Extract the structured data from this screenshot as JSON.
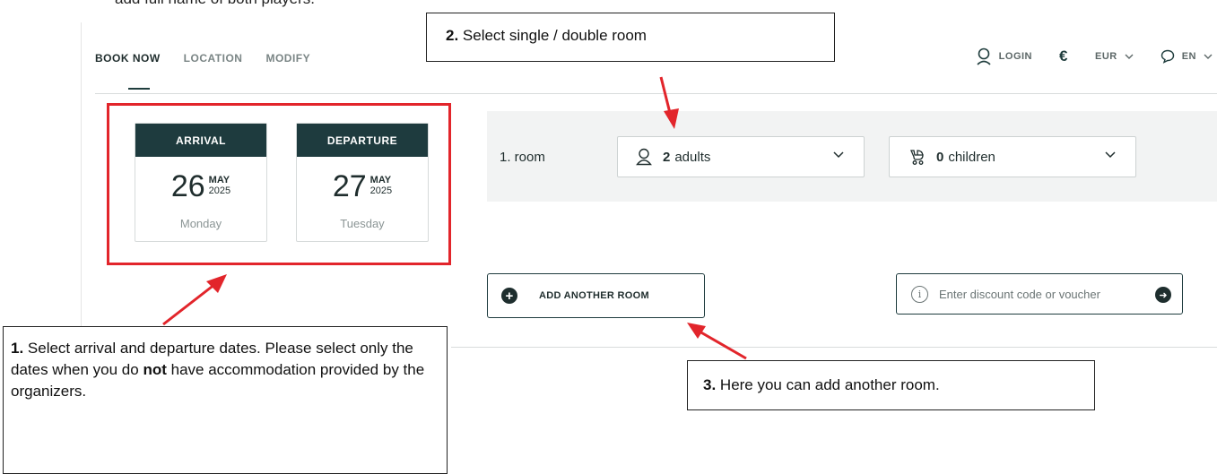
{
  "header_text": "add full name of both players.",
  "nav": {
    "tabs": [
      {
        "label": "BOOK NOW",
        "active": true
      },
      {
        "label": "LOCATION",
        "active": false
      },
      {
        "label": "MODIFY",
        "active": false
      }
    ],
    "login_label": "LOGIN",
    "currency_symbol": "€",
    "currency_label": "EUR",
    "language_label": "EN"
  },
  "arrival": {
    "label": "ARRIVAL",
    "day": "26",
    "month": "MAY",
    "year": "2025",
    "weekday": "Monday"
  },
  "departure": {
    "label": "DEPARTURE",
    "day": "27",
    "month": "MAY",
    "year": "2025",
    "weekday": "Tuesday"
  },
  "room": {
    "label": "1. room",
    "adults_count": "2",
    "adults_label": "adults",
    "children_count": "0",
    "children_label": "children"
  },
  "add_room_label": "ADD ANOTHER ROOM",
  "voucher_placeholder": "Enter discount code or voucher",
  "callouts": {
    "c1_num": "1.",
    "c1_a": " Select arrival and departure dates. Please select only the dates when you do ",
    "c1_bold": "not",
    "c1_b": " have accommodation provided by the organizers.",
    "c2_num": "2.",
    "c2_text": " Select single / double room",
    "c3_num": "3.",
    "c3_text": " Here you can add another room."
  },
  "colors": {
    "accent_dark": "#1e3b3e",
    "annotation_red": "#e2252b",
    "room_row_bg": "#f2f3f3"
  }
}
